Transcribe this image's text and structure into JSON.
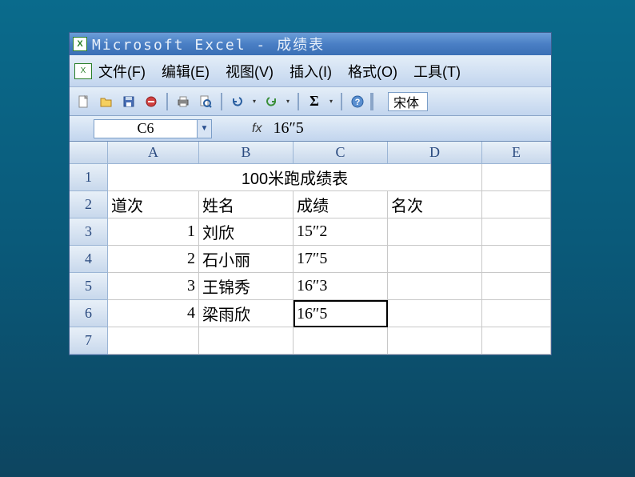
{
  "title": "Microsoft Excel - 成绩表",
  "menu": {
    "file": "文件(F)",
    "edit": "编辑(E)",
    "view": "视图(V)",
    "insert": "插入(I)",
    "format": "格式(O)",
    "tools": "工具(T)"
  },
  "toolbar": {
    "font": "宋体"
  },
  "formula_bar": {
    "cell_ref": "C6",
    "fx": "fx",
    "value": "16″5"
  },
  "columns": [
    "A",
    "B",
    "C",
    "D",
    "E"
  ],
  "rows": [
    "1",
    "2",
    "3",
    "4",
    "5",
    "6",
    "7"
  ],
  "sheet": {
    "title": "100米跑成绩表",
    "headers": {
      "lane": "道次",
      "name": "姓名",
      "score": "成绩",
      "rank": "名次"
    },
    "data": [
      {
        "lane": "1",
        "name": "刘欣",
        "score": "15″2"
      },
      {
        "lane": "2",
        "name": "石小丽",
        "score": "17″5"
      },
      {
        "lane": "3",
        "name": "王锦秀",
        "score": "16″3"
      },
      {
        "lane": "4",
        "name": "梁雨欣",
        "score": "16″5"
      }
    ]
  },
  "chart_data": {
    "type": "table",
    "title": "100米跑成绩表",
    "columns": [
      "道次",
      "姓名",
      "成绩",
      "名次"
    ],
    "rows": [
      [
        1,
        "刘欣",
        "15″2",
        null
      ],
      [
        2,
        "石小丽",
        "17″5",
        null
      ],
      [
        3,
        "王锦秀",
        "16″3",
        null
      ],
      [
        4,
        "梁雨欣",
        "16″5",
        null
      ]
    ]
  }
}
